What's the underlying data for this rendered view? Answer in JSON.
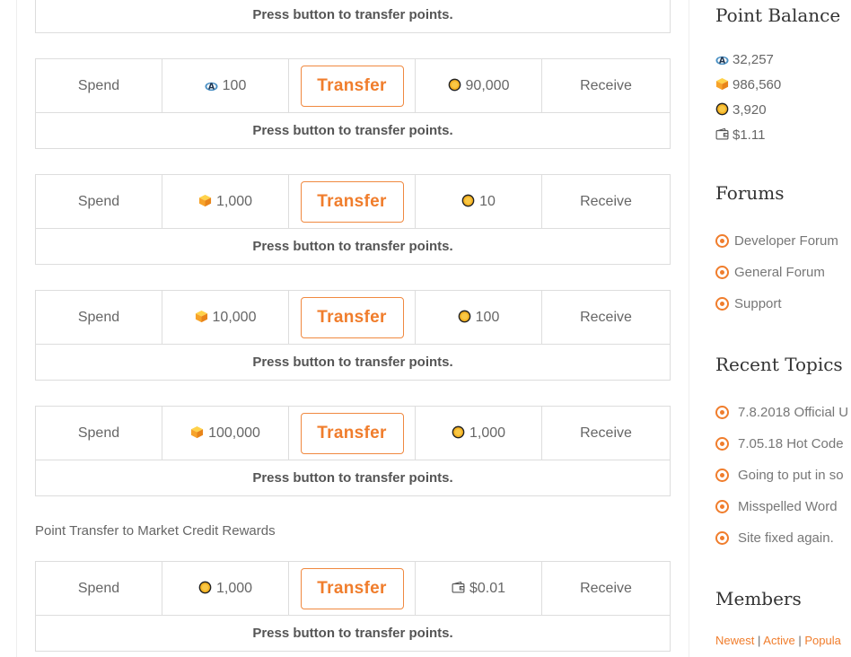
{
  "accent_color": "#f07d2c",
  "main": {
    "transfer_rows": [
      {
        "spend_label": "",
        "spend_icon": "",
        "spend_amount": "",
        "button_label": "",
        "receive_icon": "",
        "receive_amount": "",
        "receive_label": "",
        "hint": "Press button to transfer points."
      },
      {
        "spend_label": "Spend",
        "spend_icon": "a-points-icon",
        "spend_amount": "100",
        "button_label": "Transfer",
        "receive_icon": "coin-icon",
        "receive_amount": "90,000",
        "receive_label": "Receive",
        "hint": "Press button to transfer points."
      },
      {
        "spend_label": "Spend",
        "spend_icon": "cube-icon",
        "spend_amount": "1,000",
        "button_label": "Transfer",
        "receive_icon": "coin-icon",
        "receive_amount": "10",
        "receive_label": "Receive",
        "hint": "Press button to transfer points."
      },
      {
        "spend_label": "Spend",
        "spend_icon": "cube-icon",
        "spend_amount": "10,000",
        "button_label": "Transfer",
        "receive_icon": "coin-icon",
        "receive_amount": "100",
        "receive_label": "Receive",
        "hint": "Press button to transfer points."
      },
      {
        "spend_label": "Spend",
        "spend_icon": "cube-icon",
        "spend_amount": "100,000",
        "button_label": "Transfer",
        "receive_icon": "coin-icon",
        "receive_amount": "1,000",
        "receive_label": "Receive",
        "hint": "Press button to transfer points."
      }
    ],
    "market_section_title": "Point Transfer to Market Credit Rewards",
    "market_row": {
      "spend_label": "Spend",
      "spend_icon": "coin-icon",
      "spend_amount": "1,000",
      "button_label": "Transfer",
      "receive_icon": "wallet-icon",
      "receive_amount": "$0.01",
      "receive_label": "Receive",
      "hint": "Press button to transfer points."
    }
  },
  "sidebar": {
    "point_balance": {
      "title": "Point Balance",
      "items": [
        {
          "icon": "a-points-icon",
          "value": "32,257"
        },
        {
          "icon": "cube-icon",
          "value": "986,560"
        },
        {
          "icon": "coin-icon",
          "value": "3,920"
        },
        {
          "icon": "wallet-icon",
          "value": "$1.11"
        }
      ]
    },
    "forums": {
      "title": "Forums",
      "items": [
        {
          "label": "Developer Forum"
        },
        {
          "label": "General Forum"
        },
        {
          "label": "Support"
        }
      ]
    },
    "recent_topics": {
      "title": "Recent Topics",
      "items": [
        {
          "label": "7.8.2018 Official U"
        },
        {
          "label": "7.05.18 Hot Code"
        },
        {
          "label": "Going to put in so"
        },
        {
          "label": "Misspelled Word"
        },
        {
          "label": "Site fixed again."
        }
      ]
    },
    "members": {
      "title": "Members",
      "links": [
        {
          "label": "Newest"
        },
        {
          "label": "Active"
        },
        {
          "label": "Popula"
        }
      ],
      "separator": "|"
    }
  }
}
